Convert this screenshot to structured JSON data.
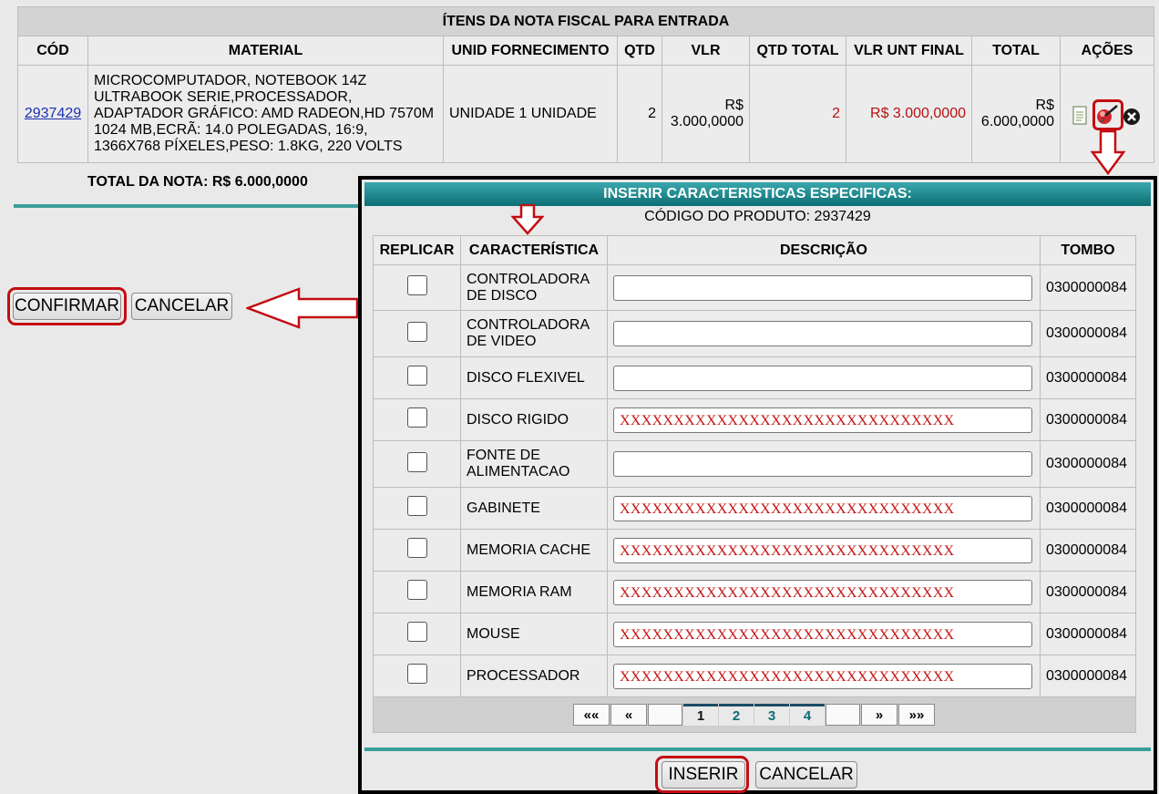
{
  "items": {
    "caption": "ÍTENS DA NOTA FISCAL PARA ENTRADA",
    "headers": [
      "CÓD",
      "MATERIAL",
      "UNID FORNECIMENTO",
      "QTD",
      "VLR",
      "QTD TOTAL",
      "VLR UNT FINAL",
      "TOTAL",
      "AÇÕES"
    ],
    "row": {
      "cod": "2937429",
      "material": "MICROCOMPUTADOR, NOTEBOOK 14Z ULTRABOOK SERIE,PROCESSADOR, ADAPTADOR GRÁFICO: AMD RADEON,HD 7570M 1024 MB,ECRÃ: 14.0 POLEGADAS, 16:9, 1366X768 PÍXELES,PESO: 1.8KG, 220 VOLTS",
      "unid": "UNIDADE 1 UNIDADE",
      "qtd": "2",
      "vlr": "R$ 3.000,0000",
      "qtd_total": "2",
      "vlr_unt_final": "R$ 3.000,0000",
      "total": "R$ 6.000,0000"
    },
    "total_nota": "TOTAL DA NOTA: R$ 6.000,0000"
  },
  "main_buttons": {
    "confirm": "CONFIRMAR",
    "cancel": "CANCELAR"
  },
  "modal": {
    "title": "INSERIR CARACTERISTICAS ESPECIFICAS:",
    "product_code": "CÓDIGO DO PRODUTO: 2937429",
    "headers": [
      "REPLICAR",
      "CARACTERÍSTICA",
      "DESCRIÇÃO",
      "TOMBO"
    ],
    "rows": [
      {
        "char": "CONTROLADORA DE DISCO",
        "desc": "",
        "tombo": "0300000084"
      },
      {
        "char": "CONTROLADORA DE VIDEO",
        "desc": "",
        "tombo": "0300000084"
      },
      {
        "char": "DISCO FLEXIVEL",
        "desc": "",
        "tombo": "0300000084"
      },
      {
        "char": "DISCO RIGIDO",
        "desc": "XXXXXXXXXXXXXXXXXXXXXXXXXXXXXXX",
        "tombo": "0300000084"
      },
      {
        "char": "FONTE DE ALIMENTACAO",
        "desc": "",
        "tombo": "0300000084"
      },
      {
        "char": "GABINETE",
        "desc": "XXXXXXXXXXXXXXXXXXXXXXXXXXXXXXX",
        "tombo": "0300000084"
      },
      {
        "char": "MEMORIA CACHE",
        "desc": "XXXXXXXXXXXXXXXXXXXXXXXXXXXXXXX",
        "tombo": "0300000084"
      },
      {
        "char": "MEMORIA RAM",
        "desc": "XXXXXXXXXXXXXXXXXXXXXXXXXXXXXXX",
        "tombo": "0300000084"
      },
      {
        "char": "MOUSE",
        "desc": "XXXXXXXXXXXXXXXXXXXXXXXXXXXXXXX",
        "tombo": "0300000084"
      },
      {
        "char": "PROCESSADOR",
        "desc": "XXXXXXXXXXXXXXXXXXXXXXXXXXXXXXX",
        "tombo": "0300000084"
      }
    ],
    "pager": {
      "first": "««",
      "prev": "«",
      "pages": [
        "1",
        "2",
        "3",
        "4"
      ],
      "current": "1",
      "next": "»",
      "last": "»»"
    },
    "insert_button": "INSERIR",
    "cancel_button": "CANCELAR"
  },
  "colors": {
    "teal": "#0c6e74",
    "highlight": "#c40d12",
    "value_red": "#b51212"
  }
}
